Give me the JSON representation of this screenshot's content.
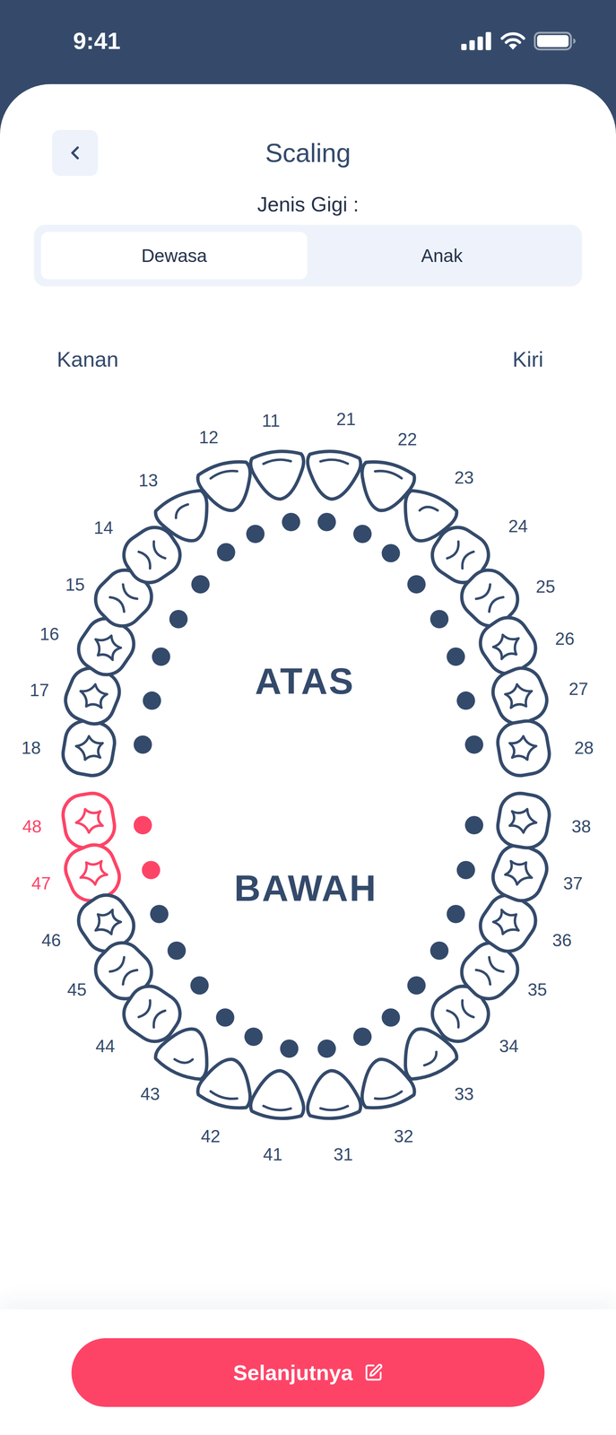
{
  "status_bar": {
    "time": "9:41"
  },
  "header": {
    "title": "Scaling"
  },
  "tooth_type": {
    "label": "Jenis Gigi :",
    "tabs": [
      {
        "label": "Dewasa",
        "selected": true
      },
      {
        "label": "Anak",
        "selected": false
      }
    ]
  },
  "chart": {
    "right_label": "Kanan",
    "left_label": "Kiri",
    "upper_label": "ATAS",
    "lower_label": "BAWAH",
    "teeth": [
      {
        "number": "18",
        "kind": "molar",
        "selected": false
      },
      {
        "number": "17",
        "kind": "molar",
        "selected": false
      },
      {
        "number": "16",
        "kind": "molar",
        "selected": false
      },
      {
        "number": "15",
        "kind": "premolar",
        "selected": false
      },
      {
        "number": "14",
        "kind": "premolar",
        "selected": false
      },
      {
        "number": "13",
        "kind": "canine",
        "selected": false
      },
      {
        "number": "12",
        "kind": "incisor",
        "selected": false
      },
      {
        "number": "11",
        "kind": "incisor",
        "selected": false
      },
      {
        "number": "21",
        "kind": "incisor",
        "selected": false
      },
      {
        "number": "22",
        "kind": "incisor",
        "selected": false
      },
      {
        "number": "23",
        "kind": "canine",
        "selected": false
      },
      {
        "number": "24",
        "kind": "premolar",
        "selected": false
      },
      {
        "number": "25",
        "kind": "premolar",
        "selected": false
      },
      {
        "number": "26",
        "kind": "molar",
        "selected": false
      },
      {
        "number": "27",
        "kind": "molar",
        "selected": false
      },
      {
        "number": "28",
        "kind": "molar",
        "selected": false
      },
      {
        "number": "48",
        "kind": "molar",
        "selected": true
      },
      {
        "number": "47",
        "kind": "molar",
        "selected": true
      },
      {
        "number": "46",
        "kind": "molar",
        "selected": false
      },
      {
        "number": "45",
        "kind": "premolar",
        "selected": false
      },
      {
        "number": "44",
        "kind": "premolar",
        "selected": false
      },
      {
        "number": "43",
        "kind": "canine",
        "selected": false
      },
      {
        "number": "42",
        "kind": "incisor",
        "selected": false
      },
      {
        "number": "41",
        "kind": "incisor",
        "selected": false
      },
      {
        "number": "31",
        "kind": "incisor",
        "selected": false
      },
      {
        "number": "32",
        "kind": "incisor",
        "selected": false
      },
      {
        "number": "33",
        "kind": "canine",
        "selected": false
      },
      {
        "number": "34",
        "kind": "premolar",
        "selected": false
      },
      {
        "number": "35",
        "kind": "premolar",
        "selected": false
      },
      {
        "number": "36",
        "kind": "molar",
        "selected": false
      },
      {
        "number": "37",
        "kind": "molar",
        "selected": false
      },
      {
        "number": "38",
        "kind": "molar",
        "selected": false
      }
    ]
  },
  "next_button": {
    "label": "Selanjutnya"
  }
}
